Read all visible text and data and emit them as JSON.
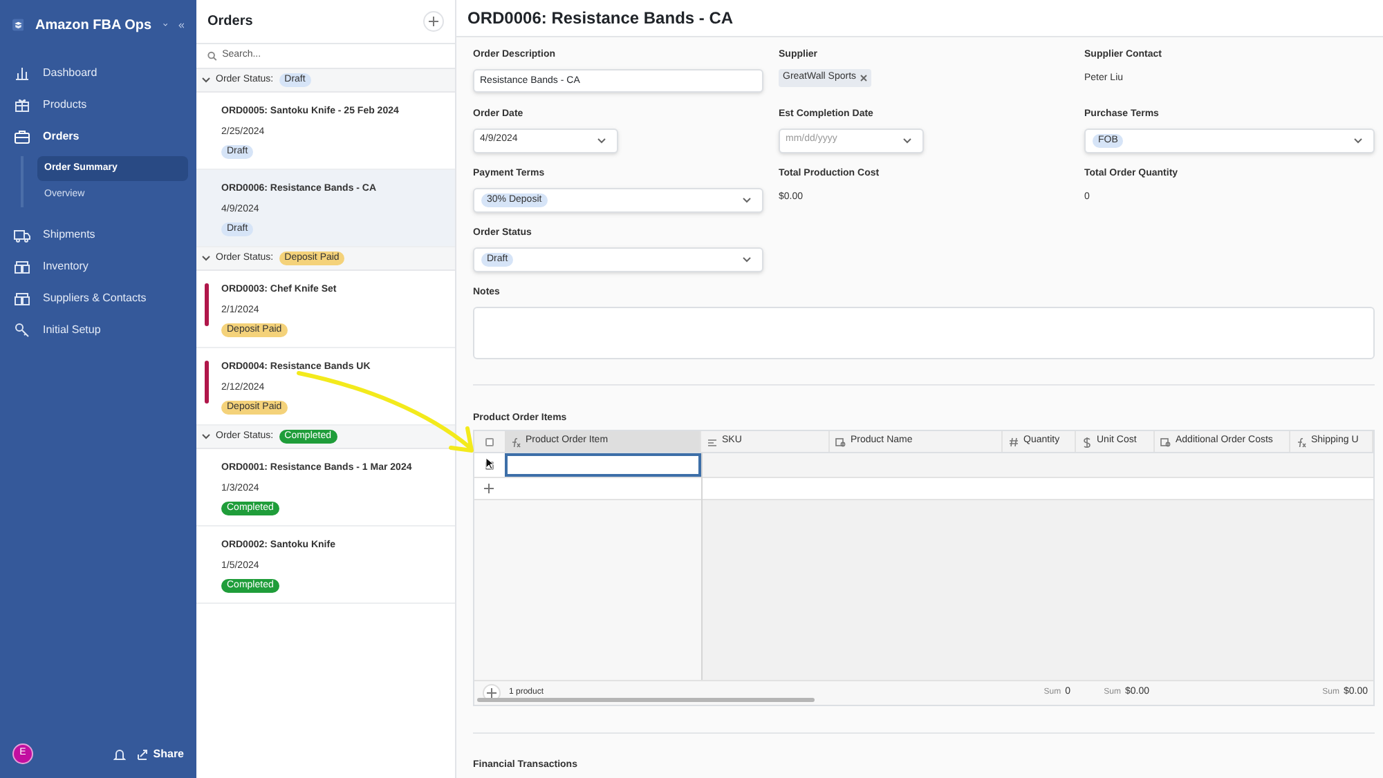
{
  "sidebar": {
    "workspace": "Amazon FBA Ops",
    "items": [
      {
        "label": "Dashboard",
        "kind": "chart",
        "selected": false
      },
      {
        "label": "Products",
        "kind": "gift",
        "selected": false
      },
      {
        "label": "Orders",
        "kind": "briefcase",
        "selected": false,
        "expanded": true,
        "children": [
          {
            "label": "Order Summary",
            "selected": true
          },
          {
            "label": "Overview",
            "selected": false
          }
        ]
      },
      {
        "label": "Shipments",
        "kind": "truck",
        "selected": false
      },
      {
        "label": "Inventory",
        "kind": "boxes",
        "selected": false
      },
      {
        "label": "Suppliers & Contacts",
        "kind": "boxes",
        "selected": false
      },
      {
        "label": "Initial Setup",
        "kind": "key",
        "selected": false
      }
    ],
    "avatar": "E",
    "share": "Share"
  },
  "orders_panel": {
    "title": "Orders",
    "search": {
      "placeholder": "Search..."
    },
    "groups": [
      {
        "label": "Order Status:",
        "status": "Draft",
        "color": "#d6e4f7",
        "expanded": true,
        "orders": [
          {
            "title": "ORD0005: Santoku Knife - 25 Feb 2024",
            "date": "2/25/2024",
            "status": "Draft",
            "selected": false,
            "flagged": false
          },
          {
            "title": "ORD0006: Resistance Bands - CA",
            "date": "4/9/2024",
            "status": "Draft",
            "selected": true,
            "flagged": false
          }
        ]
      },
      {
        "label": "Order Status:",
        "status": "Deposit Paid",
        "color": "#f4d27a",
        "expanded": true,
        "orders": [
          {
            "title": "ORD0003: Chef Knife Set",
            "date": "2/1/2024",
            "status": "Deposit Paid",
            "selected": false,
            "flagged": true
          },
          {
            "title": "ORD0004: Resistance Bands UK",
            "date": "2/12/2024",
            "status": "Deposit Paid",
            "selected": false,
            "flagged": true
          }
        ]
      },
      {
        "label": "Order Status:",
        "status": "Completed",
        "color": "#1f9d3a",
        "expanded": true,
        "orders": [
          {
            "title": "ORD0001: Resistance Bands - 1 Mar 2024",
            "date": "1/3/2024",
            "status": "Completed",
            "selected": false,
            "flagged": false
          },
          {
            "title": "ORD0002: Santoku Knife",
            "date": "1/5/2024",
            "status": "Completed",
            "selected": false,
            "flagged": false
          }
        ]
      }
    ]
  },
  "record": {
    "title": "ORD0006: Resistance Bands - CA",
    "rows": [
      [
        {
          "label": "Order Description",
          "kind": "text",
          "value": "Resistance Bands - CA"
        },
        {
          "label": "Supplier",
          "kind": "link",
          "value": "GreatWall Sports"
        },
        {
          "label": "Supplier Contact",
          "kind": "plain",
          "value": "Peter Liu"
        }
      ],
      [
        {
          "label": "Order Date",
          "kind": "date",
          "value": "4/9/2024"
        },
        {
          "label": "Est Completion Date",
          "kind": "date",
          "placeholder": "mm/dd/yyyy"
        },
        {
          "label": "Purchase Terms",
          "kind": "select",
          "value": "FOB"
        }
      ],
      [
        {
          "label": "Payment Terms",
          "kind": "select",
          "value": "30% Deposit"
        },
        {
          "label": "Total Production Cost",
          "kind": "plain",
          "value": "$0.00"
        },
        {
          "label": "Total Order Quantity",
          "kind": "plain",
          "value": "0"
        }
      ],
      [
        {
          "label": "Order Status",
          "kind": "select",
          "value": "Draft"
        }
      ]
    ],
    "notes": {
      "label": "Notes"
    },
    "items_table": {
      "title": "Product Order Items",
      "select_all": {
        "checked": false
      },
      "columns": [
        {
          "label": "Product Order Item",
          "kind": "formula",
          "selected": true
        },
        {
          "label": "SKU",
          "kind": "text",
          "selected": false
        },
        {
          "label": "Product Name",
          "kind": "lookup",
          "selected": false
        },
        {
          "label": "Quantity",
          "kind": "number",
          "selected": false,
          "sum": {
            "label": "Sum",
            "value": "0"
          }
        },
        {
          "label": "Unit Cost",
          "kind": "currency",
          "selected": false,
          "sum": {
            "label": "Sum",
            "value": "$0.00"
          }
        },
        {
          "label": "Additional Order Costs",
          "kind": "lookup",
          "selected": false
        },
        {
          "label": "Shipping U",
          "kind": "formula",
          "selected": false,
          "sum": {
            "label": "Sum",
            "value": "$0.00"
          }
        }
      ],
      "rows": [
        {
          "checked": false
        }
      ],
      "footer": {
        "count": "1 product"
      }
    },
    "next_section": "Financial Transactions"
  }
}
